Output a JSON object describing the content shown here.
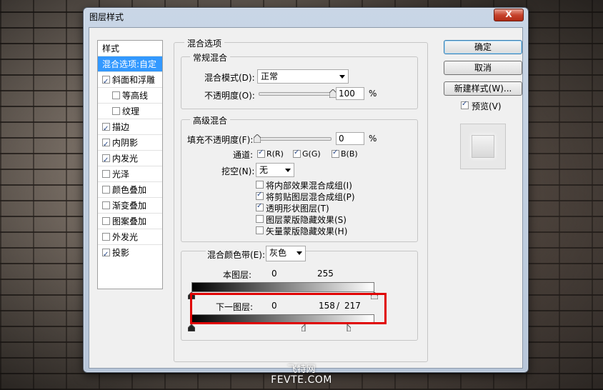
{
  "watermark": {
    "line1": "飞特网",
    "line2": "FEVTE.COM"
  },
  "window": {
    "title": "图层样式",
    "close_label": "X"
  },
  "styles_panel": {
    "header": "样式",
    "items": [
      {
        "label": "混合选项:自定",
        "selected": true,
        "has_checkbox": false
      },
      {
        "label": "斜面和浮雕",
        "checked": true,
        "has_checkbox": true
      },
      {
        "label": "等高线",
        "checked": false,
        "has_checkbox": true,
        "indent": true
      },
      {
        "label": "纹理",
        "checked": false,
        "has_checkbox": true,
        "indent": true
      },
      {
        "label": "描边",
        "checked": true,
        "has_checkbox": true
      },
      {
        "label": "内阴影",
        "checked": true,
        "has_checkbox": true
      },
      {
        "label": "内发光",
        "checked": true,
        "has_checkbox": true
      },
      {
        "label": "光泽",
        "checked": false,
        "has_checkbox": true
      },
      {
        "label": "颜色叠加",
        "checked": false,
        "has_checkbox": true
      },
      {
        "label": "渐变叠加",
        "checked": false,
        "has_checkbox": true
      },
      {
        "label": "图案叠加",
        "checked": false,
        "has_checkbox": true
      },
      {
        "label": "外发光",
        "checked": false,
        "has_checkbox": true
      },
      {
        "label": "投影",
        "checked": true,
        "has_checkbox": true
      }
    ]
  },
  "blend_options": {
    "title": "混合选项",
    "general": {
      "title": "常规混合",
      "mode_label": "混合模式(D):",
      "mode_value": "正常",
      "opacity_label": "不透明度(O):",
      "opacity_value": "100",
      "opacity_fraction": 1.0,
      "unit": "%"
    },
    "advanced": {
      "title": "高级混合",
      "fill_label": "填充不透明度(F):",
      "fill_value": "0",
      "fill_fraction": 0.0,
      "unit": "%",
      "channels_label": "通道:",
      "channels": [
        {
          "label": "R(R)",
          "checked": true
        },
        {
          "label": "G(G)",
          "checked": true
        },
        {
          "label": "B(B)",
          "checked": true
        }
      ],
      "knockout_label": "挖空(N):",
      "knockout_value": "无",
      "options": [
        {
          "label": "将内部效果混合成组(I)",
          "checked": false
        },
        {
          "label": "将剪贴图层混合成组(P)",
          "checked": true
        },
        {
          "label": "透明形状图层(T)",
          "checked": true
        },
        {
          "label": "图层蒙版隐藏效果(S)",
          "checked": false
        },
        {
          "label": "矢量蒙版隐藏效果(H)",
          "checked": false
        }
      ]
    },
    "blend_if": {
      "label": "混合颜色带(E):",
      "value": "灰色",
      "this_layer": {
        "label": "本图层:",
        "low": "0",
        "high": "255",
        "low_level": 0,
        "high_level": 255
      },
      "underlying": {
        "label": "下一图层:",
        "low": "0",
        "high_a": "158",
        "sep": "/",
        "high_b": "217",
        "low_level": 0,
        "high_a_level": 158,
        "high_b_level": 217
      }
    }
  },
  "buttons": {
    "ok": "确定",
    "cancel": "取消",
    "new_style": "新建样式(W)...",
    "preview_label": "预览(V)",
    "preview_checked": true
  },
  "colors": {
    "selection": "#3399ff",
    "highlight_box": "#e00000"
  }
}
